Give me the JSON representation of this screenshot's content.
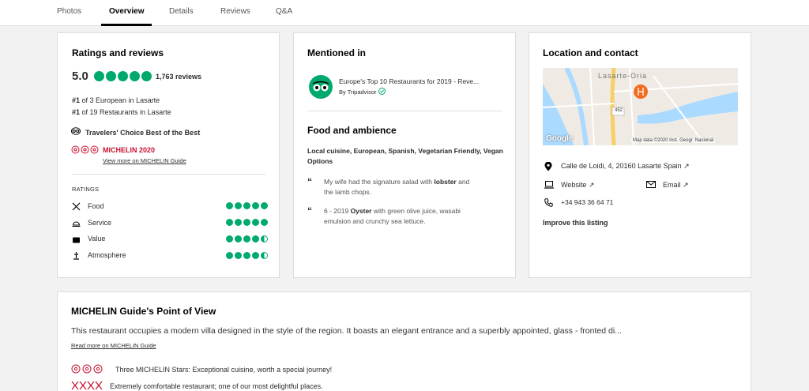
{
  "tabs": [
    {
      "label": "Photos"
    },
    {
      "label": "Overview"
    },
    {
      "label": "Details"
    },
    {
      "label": "Reviews"
    },
    {
      "label": "Q&A"
    }
  ],
  "ratings": {
    "title": "Ratings and reviews",
    "score": "5.0",
    "review_count": "1,763 reviews",
    "rank1_num": "#1",
    "rank1_text": " of 3 European in Lasarte",
    "rank2_num": "#1",
    "rank2_text": " of 19 Restaurants in Lasarte",
    "travelers_choice": "Travelers' Choice Best of the Best",
    "michelin": "MICHELIN 2020",
    "michelin_link": "View more on MICHELIN Guide",
    "ratings_heading": "RATINGS",
    "rows": [
      {
        "label": "Food",
        "score": 5
      },
      {
        "label": "Service",
        "score": 5
      },
      {
        "label": "Value",
        "score": 4.5
      },
      {
        "label": "Atmosphere",
        "score": 4.5
      }
    ]
  },
  "mentioned": {
    "title": "Mentioned in",
    "article_title": "Europe's Top 10 Restaurants for 2019 - Reve...",
    "article_by": "By Tripadvisor",
    "food_title": "Food and ambience",
    "cuisines": "Local cuisine, European, Spanish, Vegetarian Friendly, Vegan Options",
    "quote1_a": "My wife had the signature salad with ",
    "quote1_b": "lobster",
    "quote1_c": " and",
    "quote1_d": "the lamb chops.",
    "quote2_a": "6 - 2019 ",
    "quote2_b": "Oyster",
    "quote2_c": " with green olive juice, wasabi",
    "quote2_d": "emulsion and crunchy sea lettuce."
  },
  "location": {
    "title": "Location and contact",
    "map_label": "Lasarte-Oria",
    "map_road": "452",
    "map_credit": "Map data ©2020 Inst. Geogr. Nacional",
    "map_brand": "Google",
    "address": "Calle de Loidi, 4, 20160 Lasarte Spain",
    "website": "Website",
    "email": "Email",
    "phone": "+34 943 36 64 71",
    "improve": "Improve this listing"
  },
  "michelin_pov": {
    "title": "MICHELIN Guide's Point of View",
    "description": "This restaurant occupies a modern villa designed in the style of the region. It boasts an elegant entrance and a superbly appointed, glass - fronted di...",
    "read_more": "Read more on MICHELIN Guide",
    "stars_text": "Three MICHELIN Stars: Exceptional cuisine, worth a special journey!",
    "comfort_text": "Extremely comfortable restaurant; one of our most delightful places."
  },
  "colors": {
    "accent_green": "#00aa6c",
    "michelin_red": "#c8102e"
  }
}
